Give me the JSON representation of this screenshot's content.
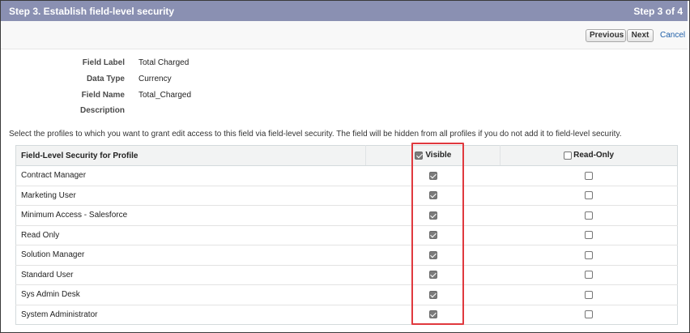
{
  "header": {
    "title": "Step 3. Establish field-level security",
    "step": "Step 3 of 4"
  },
  "toolbar": {
    "previous_label": "Previous",
    "next_label": "Next",
    "cancel_label": "Cancel"
  },
  "field_info": {
    "rows": [
      {
        "label": "Field Label",
        "value": "Total Charged"
      },
      {
        "label": "Data Type",
        "value": "Currency"
      },
      {
        "label": "Field Name",
        "value": "Total_Charged"
      },
      {
        "label": "Description",
        "value": ""
      }
    ]
  },
  "instructions": "Select the profiles to which you want to grant edit access to this field via field-level security. The field will be hidden from all profiles if you do not add it to field-level security.",
  "table": {
    "columns": {
      "profile": "Field-Level Security for Profile",
      "visible": "Visible",
      "read_only": "Read-Only"
    },
    "header_checks": {
      "visible": true,
      "read_only": false
    },
    "rows": [
      {
        "profile": "Contract Manager",
        "visible": true,
        "read_only": false
      },
      {
        "profile": "Marketing User",
        "visible": true,
        "read_only": false
      },
      {
        "profile": "Minimum Access - Salesforce",
        "visible": true,
        "read_only": false
      },
      {
        "profile": "Read Only",
        "visible": true,
        "read_only": false
      },
      {
        "profile": "Solution Manager",
        "visible": true,
        "read_only": false
      },
      {
        "profile": "Standard User",
        "visible": true,
        "read_only": false
      },
      {
        "profile": "Sys Admin Desk",
        "visible": true,
        "read_only": false
      },
      {
        "profile": "System Administrator",
        "visible": true,
        "read_only": false
      }
    ]
  },
  "colors": {
    "header_bg": "#8a90b2",
    "highlight": "#e0393e",
    "link": "#1f5fa8"
  }
}
